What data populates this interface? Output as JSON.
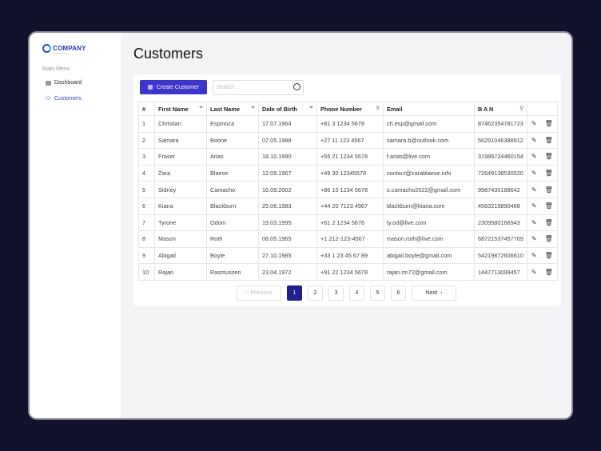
{
  "brand": {
    "name": "COMPANY",
    "slogan": "SLOGAN"
  },
  "sidebar": {
    "section": "Main Menu",
    "items": [
      {
        "label": "Dashboard",
        "icon": "briefcase-icon"
      },
      {
        "label": "Customers",
        "icon": "users-icon",
        "active": true
      }
    ]
  },
  "page_title": "Customers",
  "toolbar": {
    "create_label": "Create Customer",
    "search_placeholder": "Search..."
  },
  "table": {
    "headers": [
      "#",
      "First Name",
      "Last Name",
      "Date of Birth",
      "Phone Number",
      "Email",
      "B A N"
    ],
    "rows": [
      [
        "1",
        "Christian",
        "Espinoza",
        "17.07.1964",
        "+81 3 1234 5678",
        "ch.esp@gmail.com",
        "874623547817​23"
      ],
      [
        "2",
        "Samara",
        "Boone",
        "07.05.1988",
        "+27 11 123 4567",
        "samara.b@outlook.com",
        "562910463889​12"
      ],
      [
        "3",
        "Fraser",
        "Arias",
        "18.10.1990",
        "+55 21 1234 5678",
        "f.arias@live.com",
        "319867244601​54"
      ],
      [
        "4",
        "Zara",
        "Blaese",
        "12.09.1967",
        "+49 30 12345678",
        "contact@zarablaese.info",
        "726491385305​20"
      ],
      [
        "5",
        "Sidney",
        "Camacho",
        "16.09.2002",
        "+86 10 1234 5678",
        "s.camacho2022@gmail.com",
        "9987430188642"
      ],
      [
        "6",
        "Kiana",
        "Blackburn",
        "25.06.1983",
        "+44 20 7123 4567",
        "blackburn@kiana.com",
        "4563215890468"
      ],
      [
        "7",
        "Tyrone",
        "Odom",
        "19.03.1995",
        "+61 2 1234 5678",
        "ty.od@live.com",
        "2309580166943"
      ],
      [
        "8",
        "Mason",
        "Roth",
        "08.05.1965",
        "+1 212-123-4567",
        "mason.roth@live.com",
        "687215374577​69"
      ],
      [
        "9",
        "Abigail",
        "Boyle",
        "27.10.1985",
        "+33 1 23 45 67 89",
        "abigail.boyle@gmail.com",
        "542198726066​10"
      ],
      [
        "10",
        "Rajan",
        "Rasmussen",
        "23.04.1972",
        "+91 22 1234 5678",
        "rajan.rm72@gmail.com",
        "144771309945​7"
      ]
    ]
  },
  "pagination": {
    "previous": "Previous",
    "next": "Next",
    "pages": [
      "1",
      "2",
      "3",
      "4",
      "5",
      "6"
    ],
    "current": "1"
  },
  "colors": {
    "accent": "#3b35c9",
    "current_page": "#1f1f8f",
    "frame": "#12122b"
  }
}
